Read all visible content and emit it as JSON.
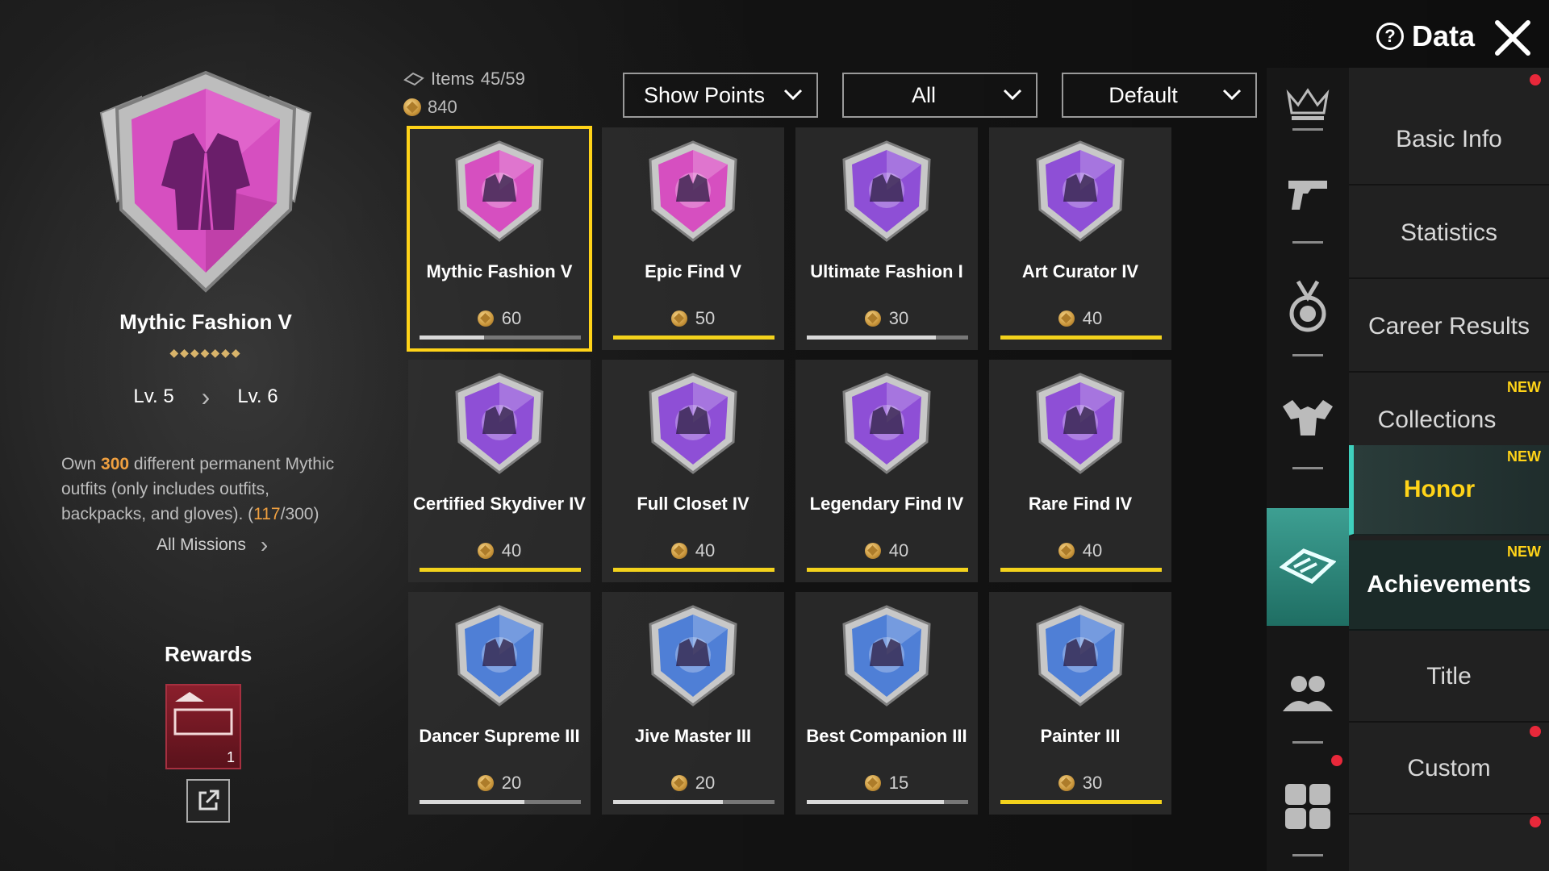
{
  "header": {
    "items_label": "Items",
    "items_count": "45/59",
    "points": "840",
    "data_label": "Data"
  },
  "filters": {
    "show_points": "Show Points",
    "category": "All",
    "sort": "Default"
  },
  "detail": {
    "title": "Mythic Fashion V",
    "stars": "◆◆◆◆◆◆◆",
    "level_from": "Lv. 5",
    "level_to": "Lv. 6",
    "desc_pre": "Own ",
    "desc_num": "300",
    "desc_mid": " different permanent Mythic outfits (only includes outfits, backpacks, and gloves). (",
    "desc_prog": "117",
    "desc_end": "/300)",
    "all_missions": "All Missions",
    "rewards_label": "Rewards",
    "reward_count": "1"
  },
  "achievements": [
    {
      "name": "Mythic Fashion V",
      "points": "60",
      "progress": 0.4,
      "fill": "grey",
      "icon": "jacket-icon",
      "tier": "pink",
      "selected": true
    },
    {
      "name": "Epic Find V",
      "points": "50",
      "progress": 1.0,
      "fill": "gold",
      "icon": "open-jacket-icon",
      "tier": "pink"
    },
    {
      "name": "Ultimate Fashion I",
      "points": "30",
      "progress": 0.8,
      "fill": "grey",
      "icon": "diamond-icon",
      "tier": "purple"
    },
    {
      "name": "Art Curator IV",
      "points": "40",
      "progress": 1.0,
      "fill": "gold",
      "icon": "claw-marks-icon",
      "tier": "purple"
    },
    {
      "name": "Certified Skydiver IV",
      "points": "40",
      "progress": 1.0,
      "fill": "gold",
      "icon": "parachute-icon",
      "tier": "purple"
    },
    {
      "name": "Full Closet IV",
      "points": "40",
      "progress": 1.0,
      "fill": "gold",
      "icon": "wardrobe-icon",
      "tier": "purple"
    },
    {
      "name": "Legendary Find IV",
      "points": "40",
      "progress": 1.0,
      "fill": "gold",
      "icon": "ribbon-jacket-icon",
      "tier": "purple"
    },
    {
      "name": "Rare Find IV",
      "points": "40",
      "progress": 1.0,
      "fill": "gold",
      "icon": "vest-icon",
      "tier": "purple"
    },
    {
      "name": "Dancer Supreme III",
      "points": "20",
      "progress": 0.65,
      "fill": "grey",
      "icon": "dancer-icon",
      "tier": "blue"
    },
    {
      "name": "Jive Master III",
      "points": "20",
      "progress": 0.68,
      "fill": "grey",
      "icon": "jive-dancer-icon",
      "tier": "blue"
    },
    {
      "name": "Best Companion III",
      "points": "15",
      "progress": 0.85,
      "fill": "grey",
      "icon": "eagle-icon",
      "tier": "blue"
    },
    {
      "name": "Painter III",
      "points": "30",
      "progress": 1.0,
      "fill": "gold",
      "icon": "rifle-crosshair-icon",
      "tier": "blue"
    }
  ],
  "nav": {
    "basic_info": "Basic Info",
    "statistics": "Statistics",
    "career_results": "Career Results",
    "collections": "Collections",
    "honor": "Honor",
    "achievements": "Achievements",
    "title": "Title",
    "custom": "Custom",
    "new_tag": "NEW"
  },
  "colors": {
    "accent_gold": "#ffd318",
    "accent_teal": "#3fd0bd",
    "highlight_orange": "#f0a040",
    "badge_pink": "#d64fc0",
    "badge_purple": "#8e4fd6",
    "badge_blue": "#4f7fd6"
  }
}
